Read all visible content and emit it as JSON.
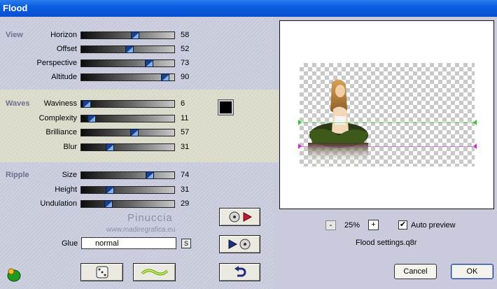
{
  "window": {
    "title": "Flood"
  },
  "sections": {
    "view": "View",
    "waves": "Waves",
    "ripple": "Ripple"
  },
  "sliders": {
    "horizon": {
      "label": "Horizon",
      "value": 58
    },
    "offset": {
      "label": "Offset",
      "value": 52
    },
    "perspective": {
      "label": "Perspective",
      "value": 73
    },
    "altitude": {
      "label": "Altitude",
      "value": 90
    },
    "waviness": {
      "label": "Waviness",
      "value": 6
    },
    "complexity": {
      "label": "Complexity",
      "value": 11
    },
    "brilliance": {
      "label": "Brilliance",
      "value": 57
    },
    "blur": {
      "label": "Blur",
      "value": 31
    },
    "size": {
      "label": "Size",
      "value": 74
    },
    "height": {
      "label": "Height",
      "value": 31
    },
    "undulation": {
      "label": "Undulation",
      "value": 29
    }
  },
  "waves_color": "#000000",
  "watermark": {
    "line1": "Pinuccia",
    "line2": "www.madiregrafica.eu"
  },
  "glue": {
    "label": "Glue",
    "value": "normal",
    "button": "S"
  },
  "preview": {
    "zoom": "25%",
    "zoom_minus": "-",
    "zoom_plus": "+",
    "auto_preview_label": "Auto preview",
    "auto_preview_checked": "✔",
    "settings_file": "Flood settings.q8r"
  },
  "buttons": {
    "cancel": "Cancel",
    "ok": "OK"
  },
  "colors": {
    "title": "#0a5ee0",
    "section": "#6d7190",
    "thumb": "#1a3f8a"
  }
}
